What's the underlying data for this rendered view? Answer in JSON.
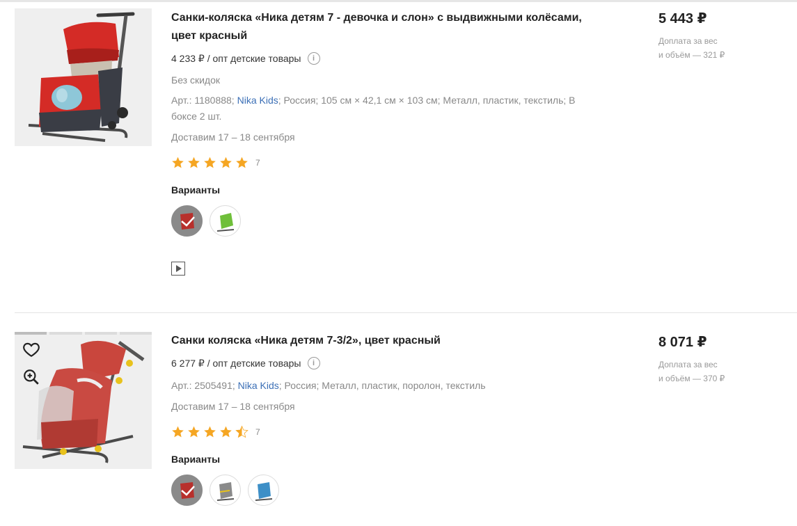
{
  "products": [
    {
      "title": "Санки-коляска «Ника детям 7 - девочка и слон» с выдвижными колёсами, цвет красный",
      "opt_price": "4 233 ₽ / опт детские товары",
      "discount": "Без скидок",
      "meta_prefix": "Арт.: 1180888;",
      "brand": "Nika Kids",
      "meta_suffix": "; Россия; 105 см × 42,1 см × 103 см; Металл, пластик, текстиль; В боксе 2 шт.",
      "delivery": "Доставим 17 – 18 сентября",
      "rating": 5,
      "rating_count": "7",
      "variants_label": "Варианты",
      "price": "5 443 ₽",
      "surcharge_line1": "Доплата за вес",
      "surcharge_line2": "и объём — 321 ₽",
      "variant_colors": [
        "#b8302c",
        "#6fbf3a"
      ]
    },
    {
      "title": "Санки коляска «Ника детям 7-3/2», цвет красный",
      "opt_price": "6 277 ₽ / опт детские товары",
      "meta_prefix": "Арт.: 2505491;",
      "brand": "Nika Kids",
      "meta_suffix": "; Россия; Металл, пластик, поролон, текстиль",
      "delivery": "Доставим 17 – 18 сентября",
      "rating": 4.5,
      "rating_count": "7",
      "variants_label": "Варианты",
      "price": "8 071 ₽",
      "surcharge_line1": "Доплата за вес",
      "surcharge_line2": "и объём — 370 ₽",
      "variant_colors": [
        "#b8302c",
        "#8a8a8a",
        "#3d8fc7"
      ]
    }
  ],
  "colors": {
    "accent_star": "#f5a623",
    "link": "#3b6fb6"
  },
  "icons": {
    "info": "info-circle-icon",
    "favorite": "heart-outline-icon",
    "zoom": "zoom-in-icon",
    "video": "play-video-icon",
    "selected_check": "check-icon"
  }
}
